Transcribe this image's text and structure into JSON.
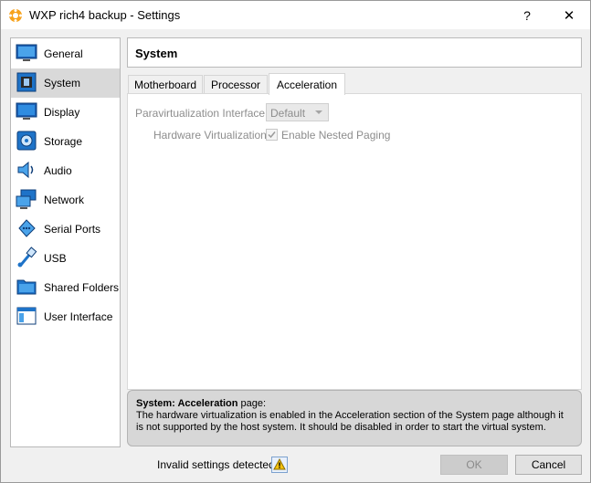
{
  "window": {
    "title": "WXP rich4 backup - Settings",
    "help_label": "?",
    "close_label": "✕"
  },
  "sidebar": {
    "items": [
      {
        "label": "General",
        "icon": "general-icon"
      },
      {
        "label": "System",
        "icon": "system-icon",
        "selected": true
      },
      {
        "label": "Display",
        "icon": "display-icon"
      },
      {
        "label": "Storage",
        "icon": "storage-icon"
      },
      {
        "label": "Audio",
        "icon": "audio-icon"
      },
      {
        "label": "Network",
        "icon": "network-icon"
      },
      {
        "label": "Serial Ports",
        "icon": "serial-ports-icon"
      },
      {
        "label": "USB",
        "icon": "usb-icon"
      },
      {
        "label": "Shared Folders",
        "icon": "shared-folders-icon"
      },
      {
        "label": "User Interface",
        "icon": "user-interface-icon"
      }
    ]
  },
  "header": {
    "title": "System"
  },
  "tabs": [
    {
      "label": "Motherboard"
    },
    {
      "label": "Processor"
    },
    {
      "label": "Acceleration",
      "active": true
    }
  ],
  "acceleration": {
    "paravirt_label": "Paravirtualization Interface:",
    "paravirt_value": "Default",
    "hwvirt_label": "Hardware Virtualization:",
    "nested_paging_label": "Enable Nested Paging",
    "nested_paging_checked": true
  },
  "info": {
    "title": "System: Acceleration",
    "title_suffix": " page:",
    "message": "The hardware virtualization is enabled in the Acceleration section of the System page although it is not supported by the host system. It should be disabled in order to start the virtual system."
  },
  "footer": {
    "warning_text": "Invalid settings detected",
    "ok_label": "OK",
    "cancel_label": "Cancel"
  },
  "colors": {
    "selected_bg": "#d9d9d9",
    "icon_blue": "#1e73c8",
    "disabled_text": "#8d8d8d"
  }
}
